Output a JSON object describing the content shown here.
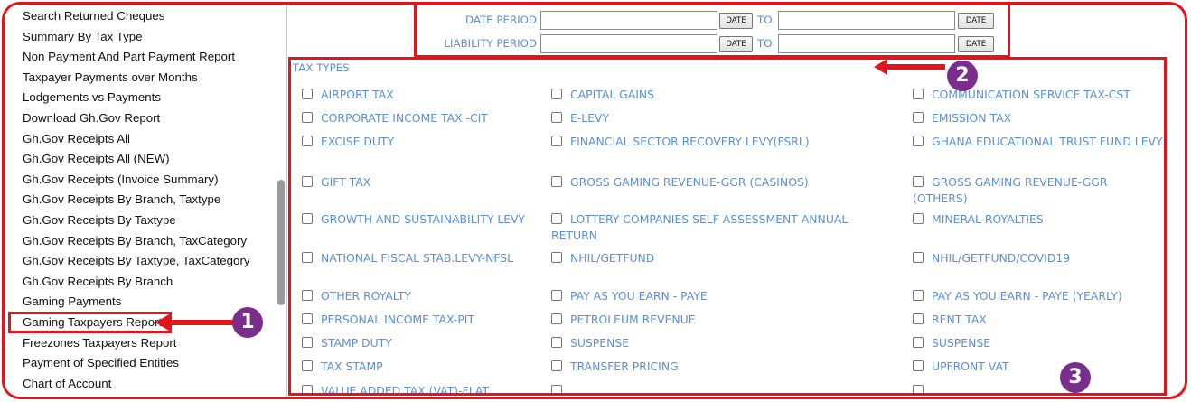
{
  "sidebar": {
    "items": [
      "Search Returned Cheques",
      "Summary By Tax Type",
      "Non Payment And Part Payment Report",
      "Taxpayer Payments over Months",
      "Lodgements vs Payments",
      "Download Gh.Gov Report",
      "Gh.Gov Receipts All",
      "Gh.Gov Receipts All (NEW)",
      "Gh.Gov Receipts (Invoice Summary)",
      "Gh.Gov Receipts By Branch, Taxtype",
      "Gh.Gov Receipts By Taxtype",
      "Gh.Gov Receipts By Branch, TaxCategory",
      "Gh.Gov Receipts By Taxtype, TaxCategory",
      "Gh.Gov Receipts By Branch",
      "Gaming Payments",
      "Gaming Taxpayers Report",
      "Freezones Taxpayers Report",
      "Payment of Specified Entities",
      "Chart of Account"
    ]
  },
  "filters": {
    "date_period_label": "DATE PERIOD",
    "liability_period_label": "LIABILITY PERIOD",
    "to_label": "TO",
    "date_button": "DATE",
    "date_from_value": "",
    "date_to_value": "",
    "liability_from_value": "",
    "liability_to_value": ""
  },
  "tax_types": {
    "header": "TAX TYPES",
    "rows": [
      [
        "AIRPORT TAX",
        "CAPITAL GAINS",
        "COMMUNICATION SERVICE TAX-CST"
      ],
      [
        "CORPORATE INCOME TAX -CIT",
        "E-LEVY",
        "EMISSION TAX"
      ],
      [
        "EXCISE DUTY",
        "FINANCIAL SECTOR RECOVERY LEVY(FSRL)",
        "GHANA EDUCATIONAL TRUST FUND LEVY"
      ],
      [
        "GIFT TAX",
        "GROSS GAMING REVENUE-GGR (CASINOS)",
        "GROSS GAMING REVENUE-GGR (OTHERS)"
      ],
      [
        "GROWTH AND SUSTAINABILITY LEVY",
        "LOTTERY COMPANIES SELF ASSESSMENT ANNUAL RETURN",
        "MINERAL ROYALTIES"
      ],
      [
        "NATIONAL FISCAL STAB.LEVY-NFSL",
        "NHIL/GETFUND",
        "NHIL/GETFUND/COVID19"
      ],
      [
        "OTHER ROYALTY",
        "PAY AS YOU EARN - PAYE",
        "PAY AS YOU EARN - PAYE (YEARLY)"
      ],
      [
        "PERSONAL INCOME TAX-PIT",
        "PETROLEUM REVENUE",
        "RENT TAX"
      ],
      [
        "STAMP DUTY",
        "SUSPENSE",
        "SUSPENSE"
      ],
      [
        "TAX STAMP",
        "TRANSFER PRICING",
        "UPFRONT VAT"
      ],
      [
        "VALUE ADDED TAX (VAT)-FLAT",
        "",
        ""
      ]
    ]
  },
  "annotations": {
    "badge_1": "1",
    "badge_2": "2",
    "badge_3": "3",
    "annotation_color": "#e3141c",
    "badge_color": "#7b2d8e"
  }
}
